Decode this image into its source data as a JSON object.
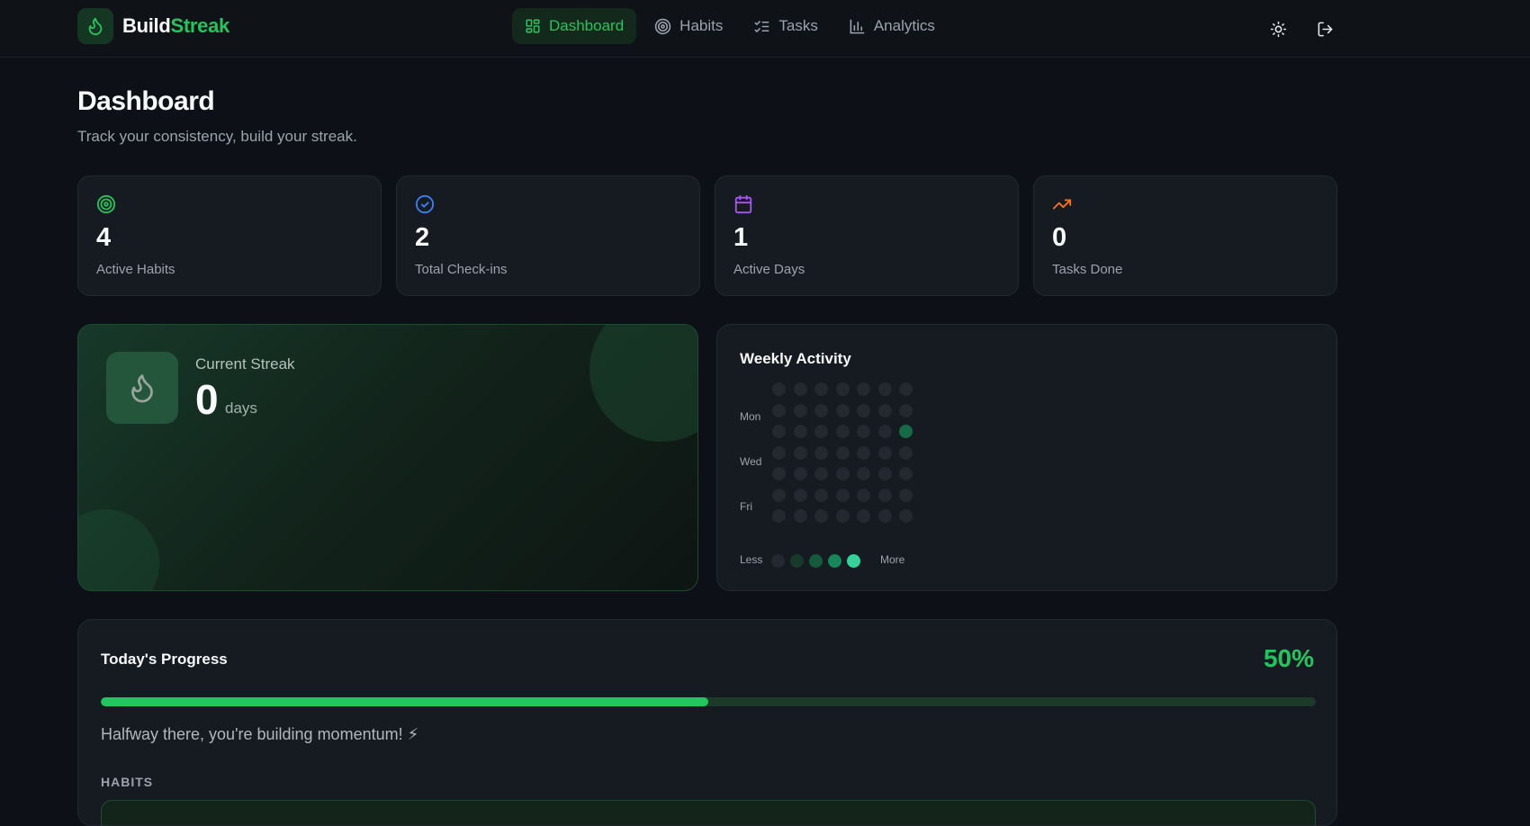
{
  "brand": {
    "part1": "Build",
    "part2": "Streak"
  },
  "nav": [
    {
      "label": "Dashboard",
      "icon": "dashboard-grid-icon",
      "active": true
    },
    {
      "label": "Habits",
      "icon": "target-icon"
    },
    {
      "label": "Tasks",
      "icon": "checklist-icon"
    },
    {
      "label": "Analytics",
      "icon": "bar-chart-icon"
    }
  ],
  "header": {
    "title": "Dashboard",
    "subtitle": "Track your consistency, build your streak."
  },
  "stats": [
    {
      "value": "4",
      "label": "Active Habits",
      "icon": "target-icon",
      "color": "#22c55e"
    },
    {
      "value": "2",
      "label": "Total Check-ins",
      "icon": "check-circle-icon",
      "color": "#3b82f6"
    },
    {
      "value": "1",
      "label": "Active Days",
      "icon": "calendar-icon",
      "color": "#a855f7"
    },
    {
      "value": "0",
      "label": "Tasks Done",
      "icon": "trending-up-icon",
      "color": "#f97316"
    }
  ],
  "streak": {
    "label": "Current Streak",
    "value": "0",
    "unit": "days",
    "icon": "flame-icon"
  },
  "weekly": {
    "title": "Weekly Activity",
    "day_labels": [
      "Mon",
      "Wed",
      "Fri"
    ],
    "active_cell": {
      "row": 3,
      "col": 7
    },
    "legend": {
      "less": "Less",
      "more": "More",
      "levels": [
        "#232831",
        "#16392a",
        "#155a3b",
        "#17875a",
        "#34d399"
      ]
    }
  },
  "progress": {
    "title": "Today's Progress",
    "percent": 50,
    "percent_text": "50%",
    "message": "Halfway there, you're building momentum! ⚡",
    "section": "HABITS"
  },
  "colors": {
    "accent": "#22c55e",
    "bg": "#0d1016",
    "card": "#161a21"
  }
}
